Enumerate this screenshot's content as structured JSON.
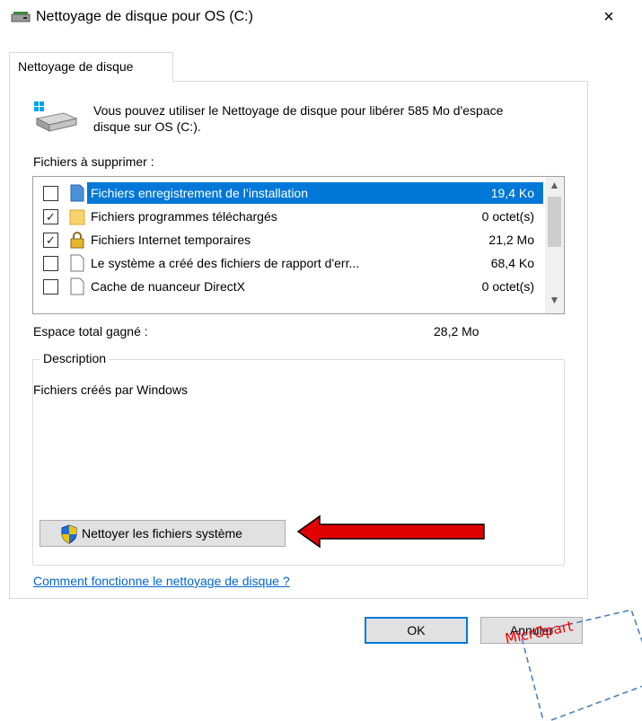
{
  "window": {
    "title": "Nettoyage de disque pour OS (C:)",
    "close_glyph": "×"
  },
  "tab": {
    "label": "Nettoyage de disque"
  },
  "intro": {
    "text": "Vous pouvez utiliser le Nettoyage de disque pour libérer 585 Mo d'espace disque sur OS (C:)."
  },
  "files": {
    "label": "Fichiers à supprimer :",
    "items": [
      {
        "name": "Fichiers enregistrement de l’installation",
        "size": "19,4 Ko",
        "checked": false,
        "selected": true,
        "icon": "blue-doc-icon"
      },
      {
        "name": "Fichiers programmes téléchargés",
        "size": "0 octet(s)",
        "checked": true,
        "selected": false,
        "icon": "folder-icon"
      },
      {
        "name": "Fichiers Internet temporaires",
        "size": "21,2 Mo",
        "checked": true,
        "selected": false,
        "icon": "lock-icon"
      },
      {
        "name": "Le système a créé des fichiers de rapport d'err...",
        "size": "68,4 Ko",
        "checked": false,
        "selected": false,
        "icon": "doc-icon"
      },
      {
        "name": "Cache de nuanceur DirectX",
        "size": "0 octet(s)",
        "checked": false,
        "selected": false,
        "icon": "doc-icon"
      }
    ]
  },
  "gain": {
    "label": "Espace total gagné :",
    "value": "28,2 Mo"
  },
  "description": {
    "legend": "Description",
    "text": "Fichiers créés par Windows"
  },
  "buttons": {
    "system_files": "Nettoyer les fichiers système",
    "ok": "OK",
    "cancel": "Annuler"
  },
  "help_link": "Comment fonctionne le nettoyage de disque ?",
  "watermark": {
    "text": "MicrOpart"
  },
  "colors": {
    "accent": "#0078d7",
    "arrow": "#e00000",
    "link": "#0066cc"
  }
}
